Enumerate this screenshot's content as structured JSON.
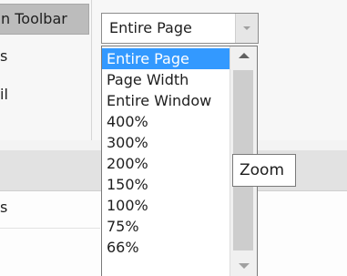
{
  "ribbon": {
    "toolbar_button_label": "n Toolbar",
    "left_fragment_1": "s",
    "left_fragment_2": "il"
  },
  "zoom_combo": {
    "value": "Entire Page"
  },
  "zoom_dropdown": {
    "options": [
      {
        "label": "Entire Page",
        "selected": true
      },
      {
        "label": "Page Width",
        "selected": false
      },
      {
        "label": "Entire Window",
        "selected": false
      },
      {
        "label": "400%",
        "selected": false
      },
      {
        "label": "300%",
        "selected": false
      },
      {
        "label": "200%",
        "selected": false
      },
      {
        "label": "150%",
        "selected": false
      },
      {
        "label": "100%",
        "selected": false
      },
      {
        "label": "75%",
        "selected": false
      },
      {
        "label": "66%",
        "selected": false
      }
    ]
  },
  "tooltip": {
    "text": "Zoom"
  },
  "lower_fragment": "s",
  "icons": {
    "combo_arrow": "chevron-down-icon",
    "scroll_up": "scroll-up-arrow-icon",
    "scroll_down": "scroll-down-arrow-icon"
  },
  "colors": {
    "selection": "#3399ff",
    "toolbar_chip": "#bcbcbc",
    "tooltip_border": "#7a7a7a"
  }
}
